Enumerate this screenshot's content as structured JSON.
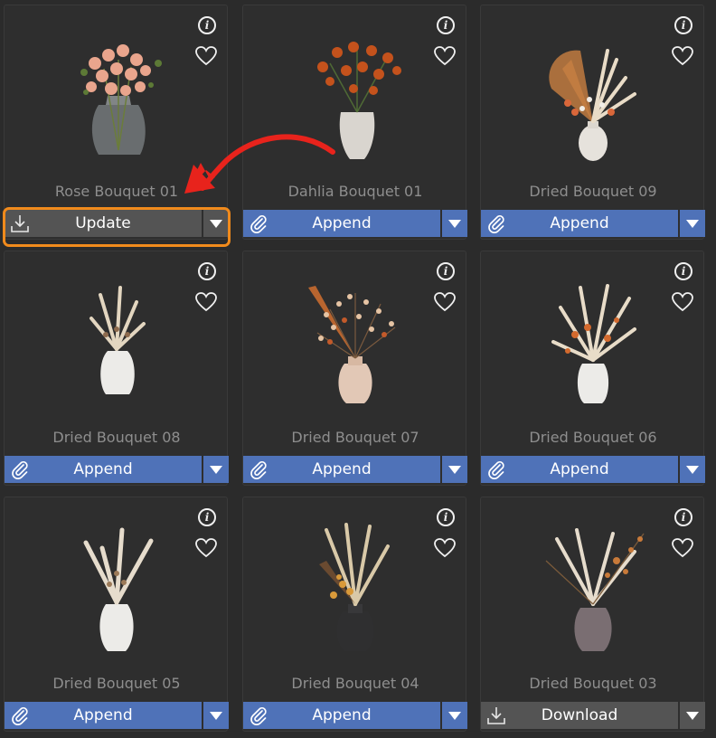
{
  "assets": [
    {
      "name": "Rose Bouquet 01",
      "button": "Update",
      "button_style": "gray",
      "lead_icon": "download-icon",
      "vase": "glass",
      "flowers": "rose"
    },
    {
      "name": "Dahlia Bouquet 01",
      "button": "Append",
      "button_style": "blue",
      "lead_icon": "paperclip-icon",
      "vase": "white",
      "flowers": "dahlia"
    },
    {
      "name": "Dried Bouquet 09",
      "button": "Append",
      "button_style": "blue",
      "lead_icon": "paperclip-icon",
      "vase": "white",
      "flowers": "dried"
    },
    {
      "name": "Dried Bouquet 08",
      "button": "Append",
      "button_style": "blue",
      "lead_icon": "paperclip-icon",
      "vase": "white",
      "flowers": "pampas"
    },
    {
      "name": "Dried Bouquet 07",
      "button": "Append",
      "button_style": "blue",
      "lead_icon": "paperclip-icon",
      "vase": "beige",
      "flowers": "wild"
    },
    {
      "name": "Dried Bouquet 06",
      "button": "Append",
      "button_style": "blue",
      "lead_icon": "paperclip-icon",
      "vase": "white",
      "flowers": "dried"
    },
    {
      "name": "Dried Bouquet 05",
      "button": "Append",
      "button_style": "blue",
      "lead_icon": "paperclip-icon",
      "vase": "white",
      "flowers": "pampas"
    },
    {
      "name": "Dried Bouquet 04",
      "button": "Append",
      "button_style": "blue",
      "lead_icon": "paperclip-icon",
      "vase": "black",
      "flowers": "pampas"
    },
    {
      "name": "Dried Bouquet 03",
      "button": "Download",
      "button_style": "gray",
      "lead_icon": "download-icon",
      "vase": "marble",
      "flowers": "dried"
    }
  ],
  "info_glyph": "i",
  "colors": {
    "append_blue": "#4f72b8",
    "gray_button": "#545454",
    "highlight_orange": "#f08a1c",
    "arrow_red": "#e8231c"
  }
}
